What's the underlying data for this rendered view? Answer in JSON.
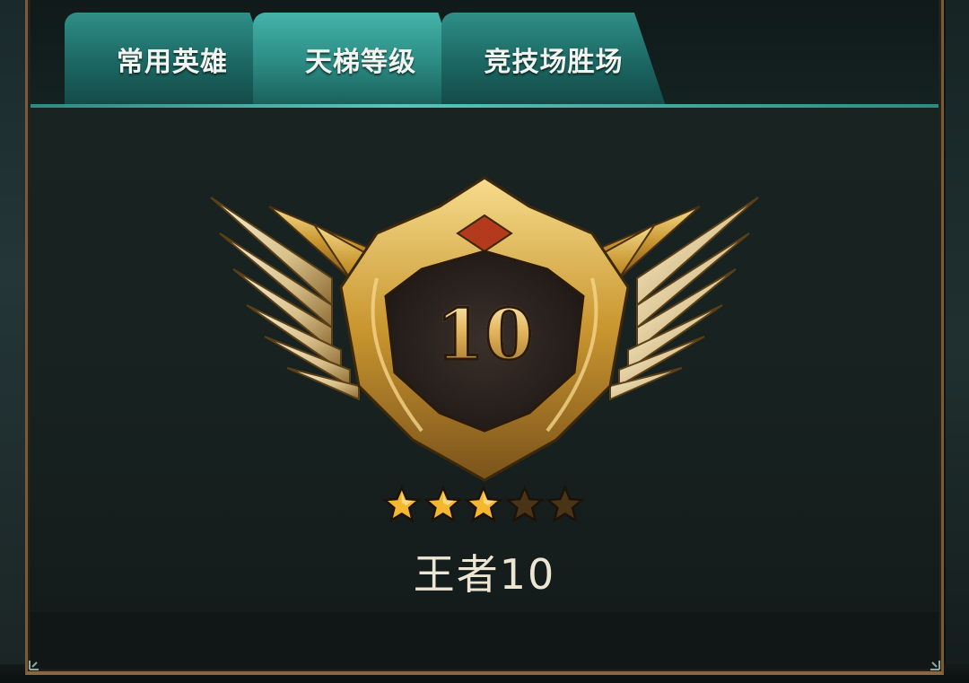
{
  "tabs": [
    {
      "label": "常用英雄",
      "active": false
    },
    {
      "label": "天梯等级",
      "active": true
    },
    {
      "label": "竞技场胜场",
      "active": false
    }
  ],
  "badge": {
    "level": "10",
    "icon": "winged-gold-rank-emblem-icon"
  },
  "stars": {
    "filled": 3,
    "total": 5,
    "filled_color": "#f5b630",
    "empty_color": "#4a3418"
  },
  "rank": {
    "title": "王者10"
  },
  "colors": {
    "tab_active": "#2b8a82",
    "tab_inactive": "#1c6662",
    "frame": "#8a6740",
    "gold": "#e3b65d"
  }
}
